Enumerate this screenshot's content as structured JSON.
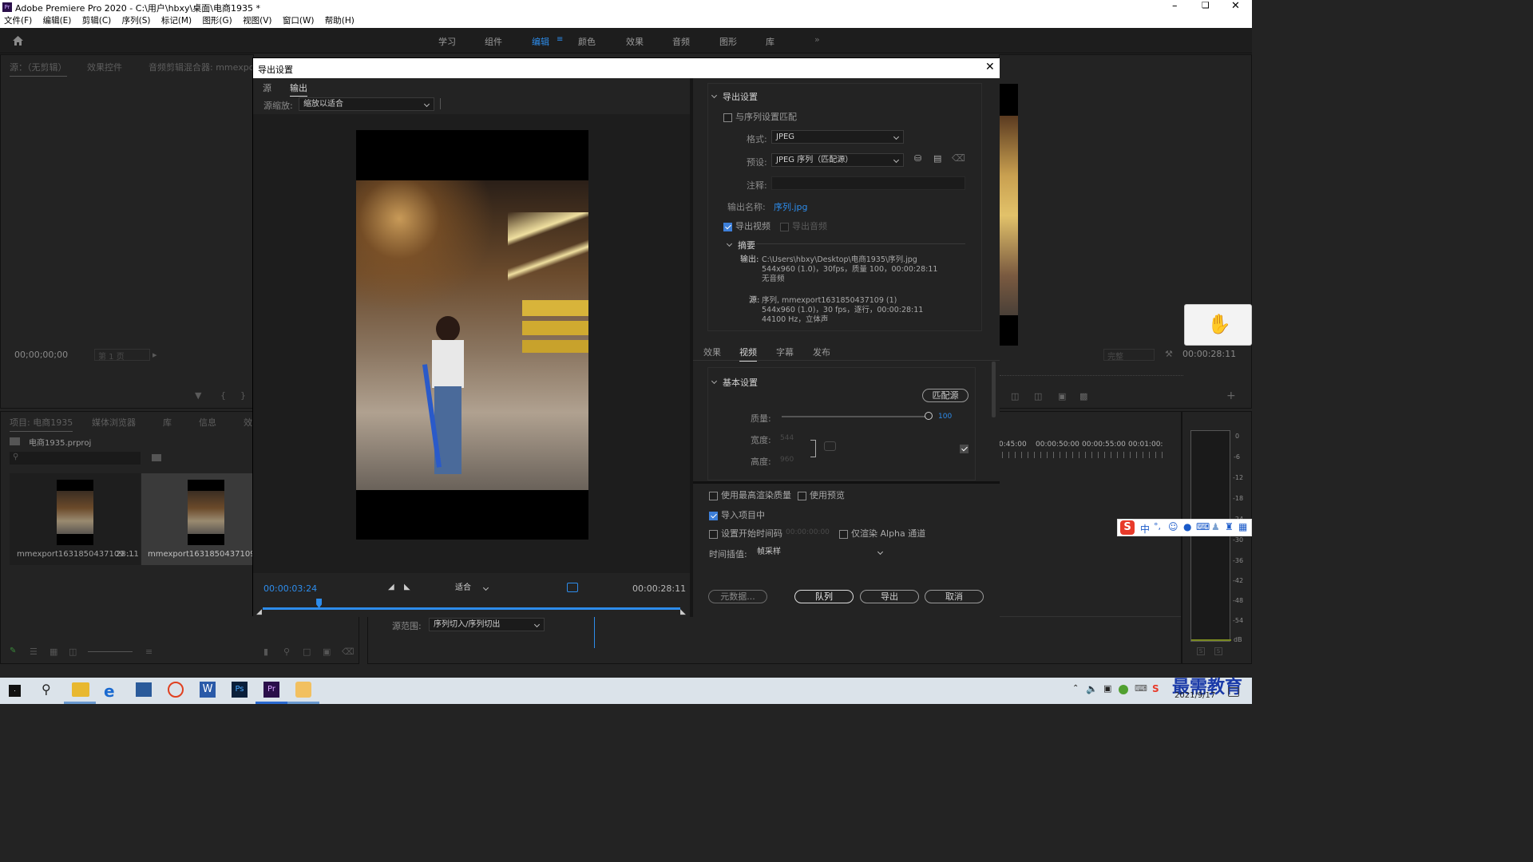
{
  "app": {
    "title": "Adobe Premiere Pro 2020 - C:\\用户\\hbxy\\桌面\\电商1935 *",
    "menu": [
      "文件(F)",
      "编辑(E)",
      "剪辑(C)",
      "序列(S)",
      "标记(M)",
      "图形(G)",
      "视图(V)",
      "窗口(W)",
      "帮助(H)"
    ],
    "workspaces": [
      "学习",
      "组件",
      "编辑",
      "颜色",
      "效果",
      "音频",
      "图形",
      "库"
    ],
    "active_workspace": "编辑"
  },
  "source_panel": {
    "tabs": [
      "源：（无剪辑）",
      "效果控件",
      "音频剪辑混合器: mmexport"
    ],
    "timecode": "00;00;00;00",
    "page": "第 1 页"
  },
  "project_panel": {
    "tabs": [
      "项目: 电商1935",
      "媒体浏览器",
      "库",
      "信息",
      "效"
    ],
    "file": "电商1935.prproj",
    "items": [
      {
        "name": "mmexport1631850437109 ...",
        "duration": "28:11"
      },
      {
        "name": "mmexport1631850437109 (1)",
        "duration": "28:11"
      }
    ]
  },
  "dialog": {
    "title": "导出设置",
    "tabs": [
      "源",
      "输出"
    ],
    "active_tab": "输出",
    "source_scaling_label": "源缩放:",
    "source_scaling_value": "缩放以适合",
    "current_time": "00:00:03:24",
    "fit": "适合",
    "end_time": "00:00:28:11",
    "playhead_fraction": 0.134,
    "range_label": "源范围:",
    "range_value": "序列切入/序列切出",
    "export_settings": {
      "header": "导出设置",
      "match_sequence": "与序列设置匹配",
      "format_label": "格式:",
      "format_value": "JPEG",
      "preset_label": "预设:",
      "preset_value": "JPEG 序列（匹配源）",
      "comment_label": "注释:",
      "output_name_label": "输出名称:",
      "output_name_value": "序列.jpg",
      "export_video": "导出视频",
      "export_audio": "导出音频",
      "summary_header": "摘要",
      "output_label": "输出:",
      "output_lines": [
        "C:\\Users\\hbxy\\Desktop\\电商1935\\序列.jpg",
        "544x960 (1.0)，30fps，质量 100，00:00:28:11",
        "无音频"
      ],
      "source_label": "源:",
      "source_lines": [
        "序列, mmexport1631850437109 (1)",
        "544x960 (1.0)，30 fps，逐行，00:00:28:11",
        "44100 Hz，立体声"
      ]
    },
    "sub_tabs": [
      "效果",
      "视频",
      "字幕",
      "发布"
    ],
    "active_sub_tab": "视频",
    "basic": {
      "header": "基本设置",
      "match_button": "匹配源",
      "quality_label": "质量:",
      "quality_value": "100",
      "width_label": "宽度:",
      "width_value": "544",
      "height_label": "高度:",
      "height_value": "960"
    },
    "bottom": {
      "max_quality": "使用最高渲染质量",
      "use_previews": "使用预览",
      "import_project": "导入项目中",
      "set_start_tc": "设置开始时间码",
      "start_tc_value": "00:00:00:00",
      "alpha_only": "仅渲染 Alpha 通道",
      "interp_label": "时间插值:",
      "interp_value": "帧采样",
      "metadata_button": "元数据...",
      "queue_button": "队列",
      "export_button": "导出",
      "cancel_button": "取消"
    }
  },
  "program_panel": {
    "timecode": "00:00:28:11",
    "quality": "完整",
    "ruler": [
      "0:45:00",
      "00:00:50:00",
      "00:00:55:00",
      "00:01:00:"
    ],
    "meter": [
      "0",
      "-6",
      "-12",
      "-18",
      "-24",
      "-30",
      "-36",
      "-42",
      "-48",
      "-54",
      "dB"
    ]
  },
  "ime": {
    "lang": "中"
  },
  "taskbar": {
    "time": "",
    "date": "2021/9/17",
    "watermark": "最需教育"
  }
}
